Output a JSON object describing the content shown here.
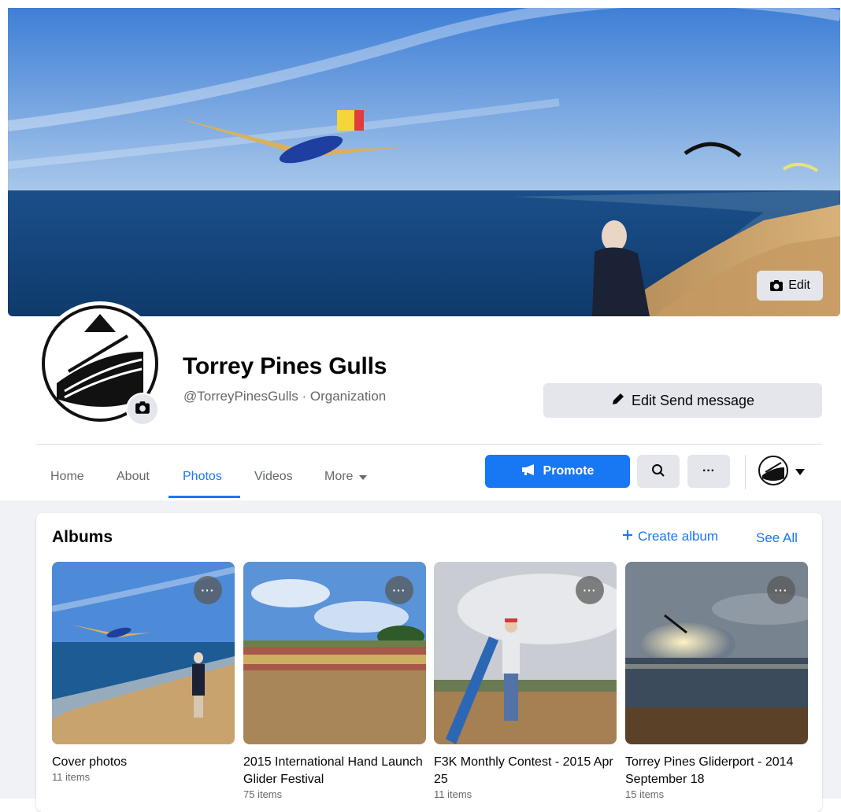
{
  "cover": {
    "edit_label": "Edit"
  },
  "page": {
    "name": "Torrey Pines Gulls",
    "subtitle": "@TorreyPinesGulls · Organization",
    "edit_send_label": "Edit Send message"
  },
  "tabs": [
    {
      "label": "Home",
      "active": false
    },
    {
      "label": "About",
      "active": false
    },
    {
      "label": "Photos",
      "active": true
    },
    {
      "label": "Videos",
      "active": false
    },
    {
      "label": "More",
      "active": false
    }
  ],
  "actions": {
    "promote_label": "Promote",
    "more_label": "···"
  },
  "albums": {
    "title": "Albums",
    "create_label": "Create album",
    "see_all_label": "See All",
    "items": [
      {
        "name": "Cover photos",
        "count": "11 items"
      },
      {
        "name": "2015 International Hand Launch Glider Festival",
        "count": "75 items"
      },
      {
        "name": "F3K Monthly Contest - 2015 Apr 25",
        "count": "11 items"
      },
      {
        "name": "Torrey Pines Gliderport - 2014 September 18",
        "count": "15 items"
      }
    ],
    "menu_label": "···"
  },
  "colors": {
    "accent": "#1877f2",
    "button_gray": "#e4e6eb",
    "secondary_text": "#65676b",
    "page_bg": "#f0f2f5"
  }
}
